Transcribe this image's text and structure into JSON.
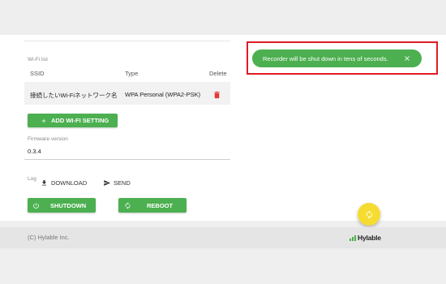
{
  "wifi": {
    "section_label": "Wi-Fi list",
    "columns": {
      "ssid": "SSID",
      "type": "Type",
      "delete": "Delete"
    },
    "rows": [
      {
        "ssid": "接続したいWi-Fiネットワーク名",
        "type": "WPA Personal (WPA2-PSK)"
      }
    ],
    "add_button": "ADD WI-FI SETTING"
  },
  "firmware": {
    "label": "Firmware version",
    "value": "0.3.4"
  },
  "log": {
    "label": "Log",
    "download": "DOWNLOAD",
    "send": "SEND"
  },
  "actions": {
    "shutdown": "SHUTDOWN",
    "reboot": "REBOOT"
  },
  "toast": {
    "message": "Recorder will be shut down in tens of seconds."
  },
  "footer": {
    "copyright": "(C) Hylable Inc.",
    "logo_text": "Hylable"
  },
  "colors": {
    "accent_green": "#4caf50",
    "delete_red": "#e53935",
    "fab_yellow": "#f6dc31",
    "highlight_red": "#e01b24"
  },
  "icons": {
    "delete": "trash-icon",
    "add": "plus-icon",
    "download": "download-icon",
    "send": "send-icon",
    "shutdown": "power-icon",
    "reboot": "refresh-icon",
    "toast_close": "close-icon",
    "fab": "refresh-icon"
  }
}
